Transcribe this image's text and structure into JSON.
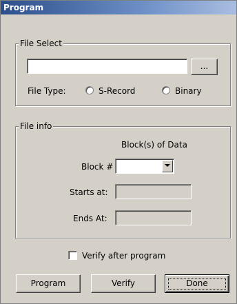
{
  "window": {
    "title": "Program"
  },
  "file_select": {
    "legend": "File Select",
    "path_value": "",
    "browse_label": "...",
    "file_type_label": "File Type:",
    "options": [
      {
        "label": "S-Record",
        "selected": false
      },
      {
        "label": "Binary",
        "selected": false
      }
    ]
  },
  "file_info": {
    "legend": "File info",
    "blocks_header": "Block(s) of Data",
    "block_label": "Block #",
    "block_value": "",
    "starts_label": "Starts at:",
    "starts_value": "",
    "ends_label": "Ends At:",
    "ends_value": ""
  },
  "verify_checkbox": {
    "label": "Verify after program",
    "checked": false
  },
  "buttons": {
    "program": "Program",
    "verify": "Verify",
    "done": "Done"
  },
  "colors": {
    "dialog_bg": "#d4d0c8",
    "title_start": "#2c4f8c",
    "title_end": "#a9bde0"
  }
}
